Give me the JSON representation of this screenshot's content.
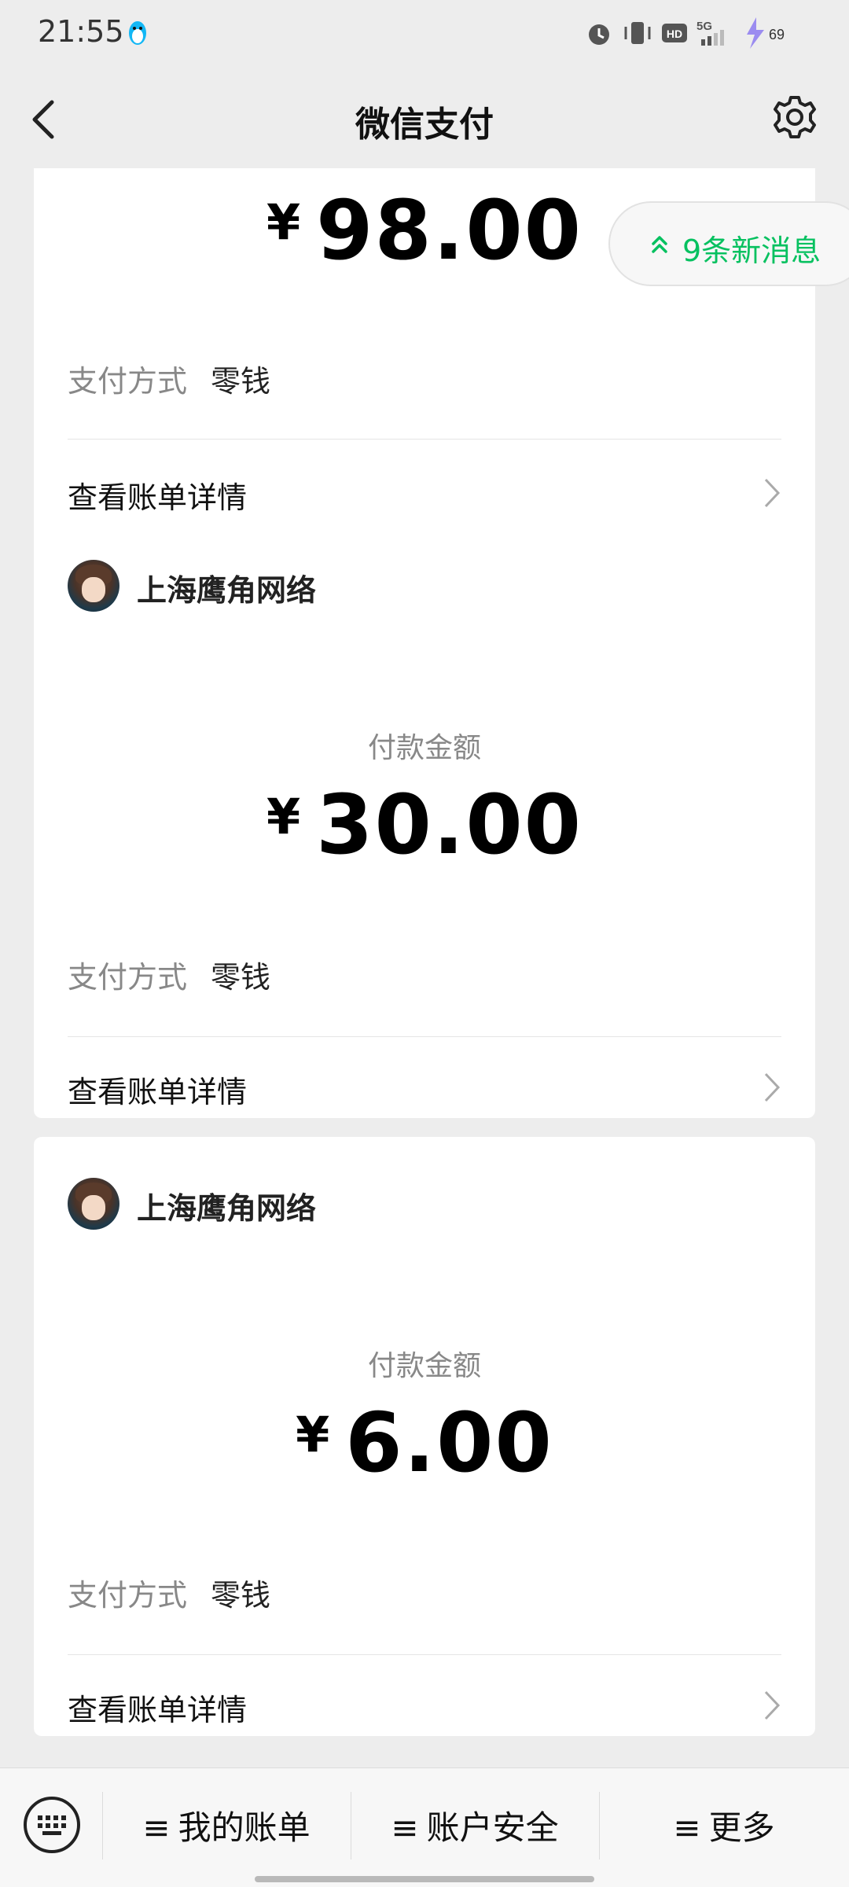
{
  "status_bar": {
    "time": "21:55",
    "network": "5G",
    "hd": "HD",
    "battery": "69"
  },
  "nav": {
    "title": "微信支付"
  },
  "new_messages": {
    "label": "9条新消息"
  },
  "payments": [
    {
      "merchant": "",
      "amount_label": "",
      "currency": "¥",
      "amount": "98.00",
      "method_label": "支付方式",
      "method_value": "零钱",
      "detail_label": "查看账单详情"
    },
    {
      "merchant": "上海鹰角网络",
      "amount_label": "付款金额",
      "currency": "¥",
      "amount": "30.00",
      "method_label": "支付方式",
      "method_value": "零钱",
      "detail_label": "查看账单详情"
    },
    {
      "merchant": "上海鹰角网络",
      "amount_label": "付款金额",
      "currency": "¥",
      "amount": "6.00",
      "method_label": "支付方式",
      "method_value": "零钱",
      "detail_label": "查看账单详情"
    }
  ],
  "bottom_bar": {
    "items": [
      {
        "label": "我的账单"
      },
      {
        "label": "账户安全"
      },
      {
        "label": "更多"
      }
    ],
    "hamburger": "≡"
  },
  "colors": {
    "accent": "#07c160",
    "background": "#ededed",
    "card": "#ffffff"
  },
  "icons": [
    "back-icon",
    "gear-icon",
    "chevron-right-icon",
    "double-chevron-up-icon",
    "keyboard-icon",
    "penguin-icon",
    "alarm-icon",
    "vibrate-icon",
    "signal-icon",
    "battery-charging-icon"
  ]
}
